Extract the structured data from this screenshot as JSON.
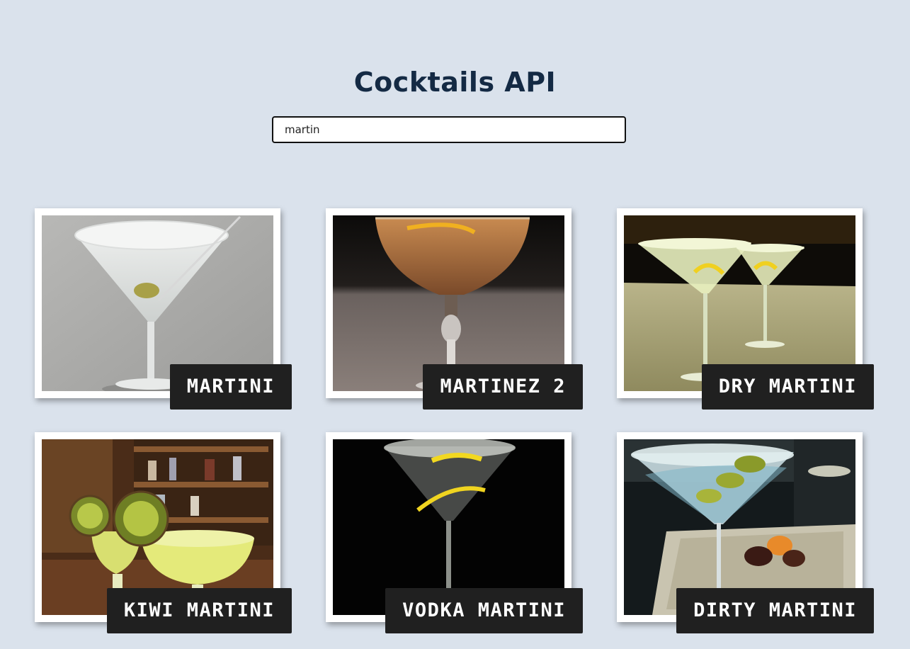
{
  "header": {
    "title": "Cocktails API"
  },
  "search": {
    "value": "martin",
    "placeholder": ""
  },
  "cocktails": [
    {
      "name": "MARTINI",
      "image": "martini-glass-olive-photo"
    },
    {
      "name": "MARTINEZ 2",
      "image": "amber-coupe-cocktail-photo"
    },
    {
      "name": "DRY MARTINI",
      "image": "two-martini-glasses-lemon-photo"
    },
    {
      "name": "KIWI MARTINI",
      "image": "kiwi-cocktails-bar-photo"
    },
    {
      "name": "VODKA MARTINI",
      "image": "martini-lemon-twist-dark-photo"
    },
    {
      "name": "DIRTY MARTINI",
      "image": "martini-olives-tray-photo"
    }
  ]
}
